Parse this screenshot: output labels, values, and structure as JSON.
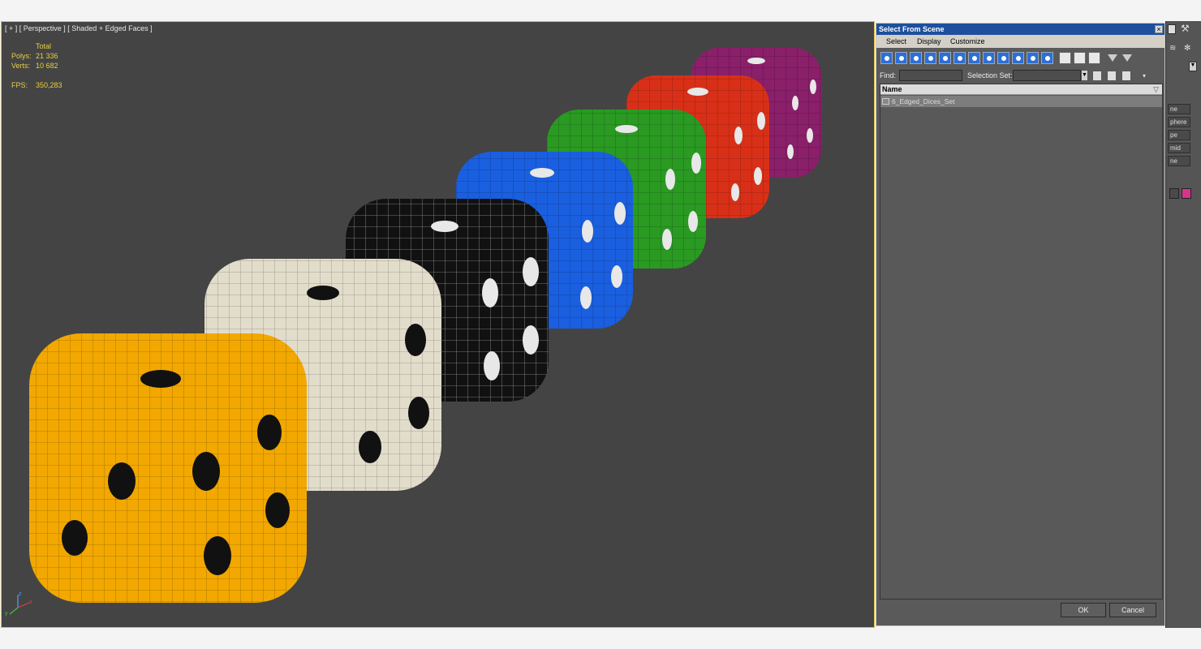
{
  "viewport": {
    "label": "[ + ] [ Perspective ] [ Shaded + Edged Faces ]",
    "stats": {
      "total_label": "Total",
      "polys_label": "Polys:",
      "polys_value": "21 336",
      "verts_label": "Verts:",
      "verts_value": "10 682",
      "fps_label": "FPS:",
      "fps_value": "350,283"
    },
    "axis": {
      "z": "z",
      "x": "x",
      "y": "y"
    },
    "dice_colors": {
      "yellow": "#f2a800",
      "white": "#e2dccb",
      "black": "#111111",
      "blue": "#1a5fe0",
      "green": "#2a9a22",
      "red": "#d83018",
      "purple": "#8a1f6a"
    }
  },
  "dialog": {
    "title": "Select From Scene",
    "close": "×",
    "menu": [
      "Select",
      "Display",
      "Customize"
    ],
    "find_label": "Find:",
    "find_value": "",
    "selection_set_label": "Selection Set:",
    "selection_set_value": "",
    "list": {
      "header": "Name",
      "sort_glyph": "▽",
      "rows": [
        "6_Edged_Dices_Set"
      ]
    },
    "ok_label": "OK",
    "cancel_label": "Cancel"
  },
  "command_panel": {
    "buttons": [
      "ne",
      "phere",
      "pe",
      "mid",
      "ne"
    ],
    "swatch_color": "#d6358a"
  }
}
